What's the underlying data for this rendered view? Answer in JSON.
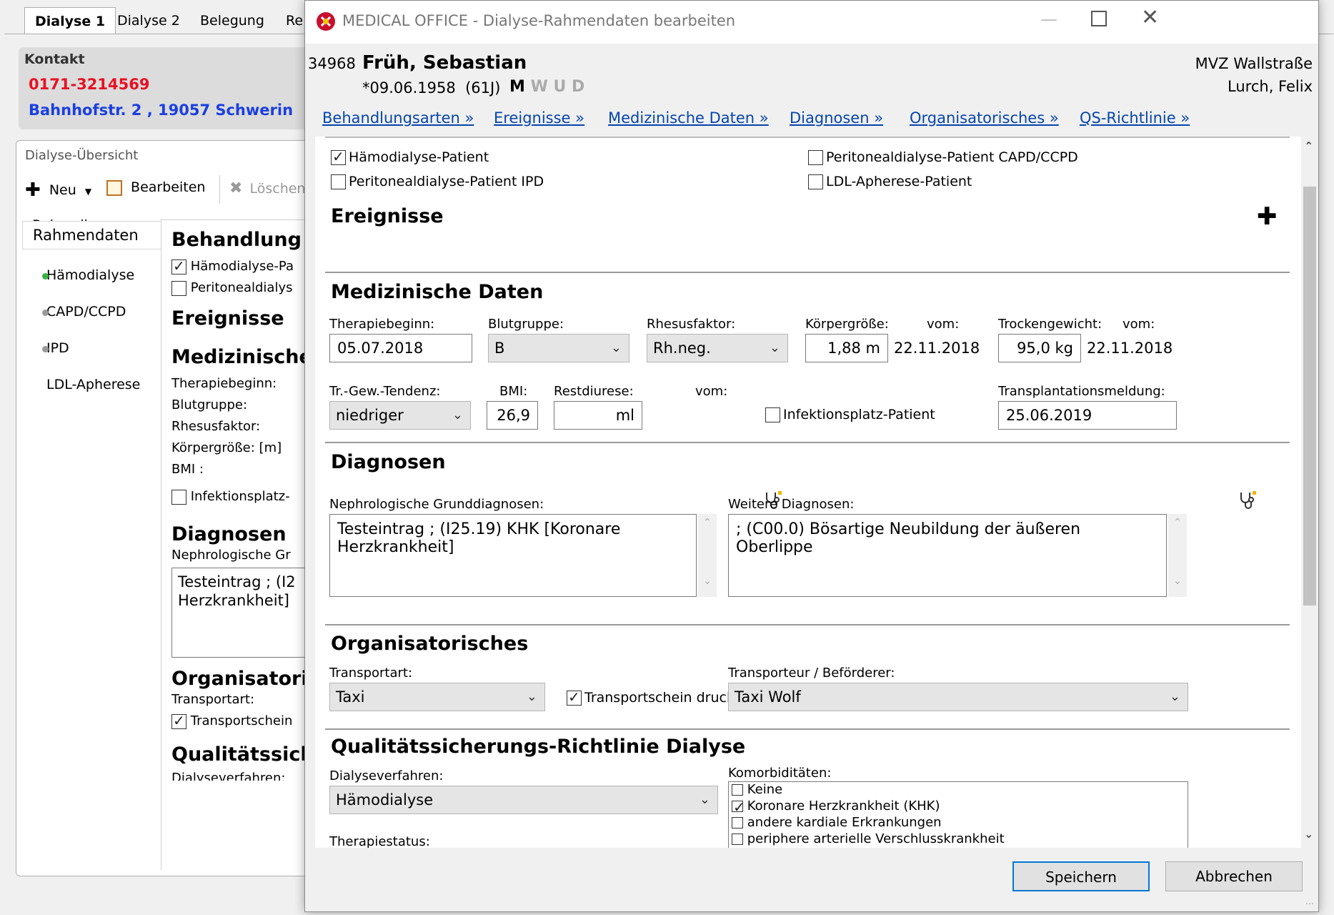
{
  "background": {
    "tabs": [
      "Dialyse 1",
      "Dialyse 2",
      "Belegung",
      "Re"
    ],
    "contact": {
      "heading": "Kontakt",
      "phone": "0171-3214569",
      "address": "Bahnhofstr. 2 , 19057 Schwerin"
    },
    "overview": {
      "title": "Dialyse-Übersicht",
      "toolbar": {
        "new": "Neu",
        "edit": "Bearbeiten",
        "delete": "Löschen"
      },
      "sidebar": [
        {
          "label": "Behandlungen"
        },
        {
          "label": "Rahmendaten"
        },
        {
          "label": "Hämodialyse"
        },
        {
          "label": "CAPD/CCPD"
        },
        {
          "label": "IPD"
        },
        {
          "label": "LDL-Apherese"
        }
      ],
      "panel": {
        "behandlung_heading": "Behandlung",
        "haemo_cb": "Hämodialyse-Pa",
        "perito_cb": "Peritonealdialys",
        "ereignisse": "Ereignisse",
        "medizin": "Medizinische",
        "therapiebeginn": "Therapiebeginn:",
        "blutgruppe": "Blutgruppe:",
        "rhesus": "Rhesusfaktor:",
        "koerper": "Körpergröße: [m]",
        "bmi": "BMI :",
        "infektion": "Infektionsplatz-",
        "diagnosen": "Diagnosen",
        "nephro": "Nephrologische Gr",
        "diag_line1": "Testeintrag ; (I2",
        "diag_line2": "Herzkrankheit]",
        "organisatori": "Organisatori",
        "transportart": "Transportart:",
        "transportschein": "Transportschein",
        "qualitaet": "Qualitätssich",
        "dialyseverf": "Dialyseverfahren:"
      }
    }
  },
  "dialog": {
    "title": "MEDICAL OFFICE - Dialyse-Rahmendaten bearbeiten",
    "patient": {
      "id": "34968",
      "name": "Früh, Sebastian",
      "birth": "*09.06.1958",
      "age": "(61J)",
      "letter_m": "M",
      "letters_wud": "W U D",
      "clinic": "MVZ Wallstraße",
      "doctor": "Lurch, Felix"
    },
    "nav": [
      "Behandlungsarten »",
      "Ereignisse »",
      "Medizinische Daten »",
      "Diagnosen »",
      "Organisatorisches »",
      "QS-Richtlinie »"
    ],
    "behandlungsarten": {
      "haemo": {
        "label": "Hämodialyse-Patient",
        "checked": true
      },
      "capd": {
        "label": "Peritonealdialyse-Patient CAPD/CCPD",
        "checked": false
      },
      "ipd": {
        "label": "Peritonealdialyse-Patient IPD",
        "checked": false
      },
      "ldl": {
        "label": "LDL-Apherese-Patient",
        "checked": false
      }
    },
    "ereignisse": {
      "title": "Ereignisse"
    },
    "medizin": {
      "title": "Medizinische Daten",
      "therapiebeginn_label": "Therapiebeginn:",
      "therapiebeginn": "05.07.2018",
      "blutgruppe_label": "Blutgruppe:",
      "blutgruppe": "B",
      "rhesus_label": "Rhesusfaktor:",
      "rhesus": "Rh.neg.",
      "koerper_label": "Körpergröße:",
      "vom_label": "vom:",
      "koerper": "1,88 m",
      "koerper_vom": "22.11.2018",
      "trocken_label": "Trockengewicht:",
      "trocken": "95,0 kg",
      "trocken_vom": "22.11.2018",
      "tendenz_label": "Tr.-Gew.-Tendenz:",
      "tendenz": "niedriger",
      "bmi_label": "BMI:",
      "bmi": "26,9",
      "restdiurese_label": "Restdiurese:",
      "restdiurese_unit": "ml",
      "infektion": {
        "label": "Infektionsplatz-Patient",
        "checked": false
      },
      "transplant_label": "Transplantationsmeldung:",
      "transplant": "25.06.2019"
    },
    "diagnosen": {
      "title": "Diagnosen",
      "nephro_label": "Nephrologische Grunddiagnosen:",
      "nephro_text": "Testeintrag ; (I25.19) KHK [Koronare Herzkrankheit]",
      "weitere_label": "Weitere Diagnosen:",
      "weitere_text": "; (C00.0) Bösartige Neubildung der äußeren Oberlippe"
    },
    "organisatorisches": {
      "title": "Organisatorisches",
      "transportart_label": "Transportart:",
      "transportart": "Taxi",
      "transportschein": {
        "label": "Transportschein drucken",
        "checked": true
      },
      "transporteur_label": "Transporteur / Beförderer:",
      "transporteur": "Taxi Wolf"
    },
    "qs": {
      "title": "Qualitätssicherungs-Richtlinie Dialyse",
      "verfahren_label": "Dialyseverfahren:",
      "verfahren": "Hämodialyse",
      "therapiestatus_label": "Therapiestatus:",
      "komorb_label": "Komorbiditäten:",
      "komorb": [
        {
          "label": "Keine",
          "checked": false
        },
        {
          "label": "Koronare Herzkrankheit (KHK)",
          "checked": true
        },
        {
          "label": "andere kardiale Erkrankungen",
          "checked": false
        },
        {
          "label": "periphere arterielle Verschlusskrankheit",
          "checked": false
        }
      ]
    },
    "buttons": {
      "save": "Speichern",
      "cancel": "Abbrechen"
    }
  }
}
